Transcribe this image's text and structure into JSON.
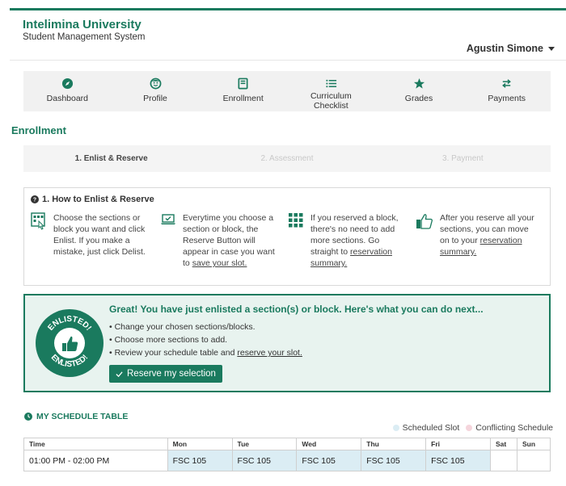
{
  "header": {
    "university": "Intelimina University",
    "system": "Student Management System",
    "user": "Agustin Simone"
  },
  "nav": [
    {
      "label": "Dashboard",
      "icon": "compass-icon"
    },
    {
      "label": "Profile",
      "icon": "smiley-icon"
    },
    {
      "label": "Enrollment",
      "icon": "book-icon"
    },
    {
      "label": "Curriculum Checklist",
      "icon": "list-icon"
    },
    {
      "label": "Grades",
      "icon": "star-icon"
    },
    {
      "label": "Payments",
      "icon": "exchange-icon"
    }
  ],
  "section_title": "Enrollment",
  "steps": [
    "1. Enlist & Reserve",
    "2. Assessment",
    "3. Payment"
  ],
  "howto": {
    "title": "1. How to Enlist & Reserve",
    "col1": "Choose the sections or block you want and click Enlist. If you make a mistake, just click Delist.",
    "col2_text": "Everytime you choose a section or block, the Reserve Button will appear in case you want to ",
    "col2_link": "save your slot.",
    "col3_text": "If you reserved a block, there's no need to add more sections. Go straight to ",
    "col3_link": "reservation summary.",
    "col4_text": "After you reserve all your sections, you can move on to your ",
    "col4_link": "reservation summary."
  },
  "enlisted": {
    "badge_top": "ENLISTED!",
    "badge_bottom": "ENLISTED!",
    "headline": "Great! You have just enlisted a section(s) or block. Here's what you can do next...",
    "bullet1": "• Change your chosen sections/blocks.",
    "bullet2": "• Choose more sections to add.",
    "bullet3_text": "• Review your schedule table and ",
    "bullet3_link": "reserve your slot.",
    "button": "Reserve my selection"
  },
  "schedule": {
    "title": "MY SCHEDULE TABLE",
    "legend_scheduled": "Scheduled Slot",
    "legend_conflicting": "Conflicting Schedule",
    "headers": [
      "Time",
      "Mon",
      "Tue",
      "Wed",
      "Thu",
      "Fri",
      "Sat",
      "Sun"
    ],
    "row": [
      "01:00 PM - 02:00 PM",
      "FSC 105",
      "FSC 105",
      "FSC 105",
      "FSC 105",
      "FSC 105",
      "",
      ""
    ]
  },
  "colors": {
    "brand": "#1a7a5e",
    "scheduled": "#dbedf4",
    "conflicting": "#f5d5dc"
  }
}
